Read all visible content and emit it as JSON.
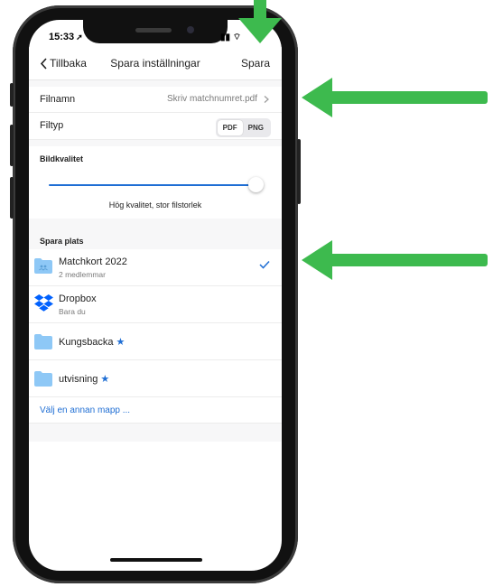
{
  "status": {
    "time": "15:33",
    "location_glyph": "➚",
    "signal_glyph": "▮▮ ⌔"
  },
  "header": {
    "back_label": "Tillbaka",
    "title": "Spara inställningar",
    "save_label": "Spara"
  },
  "filename": {
    "label": "Filnamn",
    "value": "Skriv matchnumret.pdf"
  },
  "filetype": {
    "label": "Filtyp",
    "options": [
      "PDF",
      "PNG"
    ],
    "selected": "PDF"
  },
  "quality": {
    "label": "Bildkvalitet",
    "caption": "Hög kvalitet, stor filstorlek",
    "level": 1.0
  },
  "locations": {
    "label": "Spara plats",
    "items": [
      {
        "name": "Matchkort 2022",
        "sub": "2 medlemmar",
        "icon": "shared-folder-icon",
        "selected": true,
        "starred": false
      },
      {
        "name": "Dropbox",
        "sub": "Bara du",
        "icon": "dropbox-icon",
        "selected": false,
        "starred": false
      },
      {
        "name": "Kungsbacka",
        "sub": "",
        "icon": "folder-icon",
        "selected": false,
        "starred": true
      },
      {
        "name": "utvisning",
        "sub": "",
        "icon": "folder-icon",
        "selected": false,
        "starred": true
      }
    ],
    "star_glyph": "★",
    "other_folder_label": "Välj en annan mapp ..."
  },
  "colors": {
    "accent": "#1f6ed4",
    "folder": "#8ec8f6",
    "arrow": "#3dba4e"
  }
}
